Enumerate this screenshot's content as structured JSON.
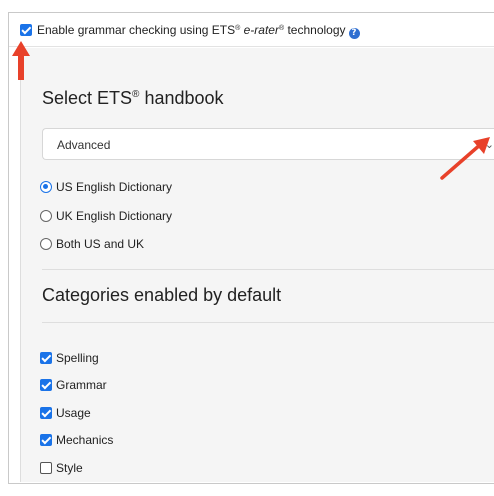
{
  "grammar_setting": {
    "enabled": true,
    "label_prefix": "Enable grammar checking using ETS",
    "reg1": "®",
    "brand": "e-rater",
    "reg2": "®",
    "label_suffix": "technology",
    "help_icon": "question-circle-icon"
  },
  "handbook": {
    "title": "Select ETS",
    "title_reg": "®",
    "title_suffix": "handbook",
    "selected": "Advanced",
    "chevron": "chevron-down-icon",
    "options": [
      {
        "label": "US English Dictionary",
        "selected": true
      },
      {
        "label": "UK English Dictionary",
        "selected": false
      },
      {
        "label": "Both US and UK",
        "selected": false
      }
    ]
  },
  "categories": {
    "title": "Categories enabled by default",
    "items": [
      {
        "label": "Spelling",
        "checked": true
      },
      {
        "label": "Grammar",
        "checked": true
      },
      {
        "label": "Usage",
        "checked": true
      },
      {
        "label": "Mechanics",
        "checked": true
      },
      {
        "label": "Style",
        "checked": false
      }
    ]
  },
  "colors": {
    "accent": "#1a73e8",
    "annotation_arrow": "#e8412a",
    "panel_bg": "#f5f5f5"
  }
}
